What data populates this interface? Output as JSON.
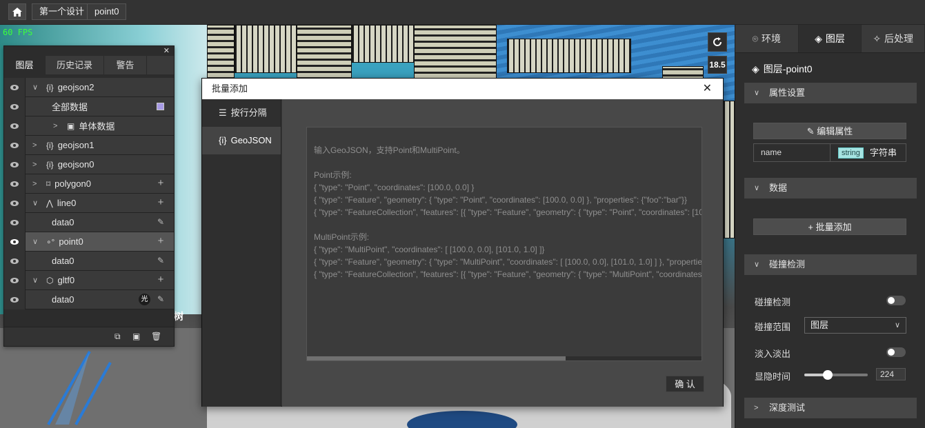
{
  "topbar": {
    "breadcrumbs": [
      "第一个设计",
      "point0"
    ]
  },
  "viewport": {
    "fps": "60 FPS",
    "height_readout": "18.5",
    "building_label": "树"
  },
  "layers_panel": {
    "tabs": [
      "图层",
      "历史记录",
      "警告"
    ],
    "rows": [
      {
        "label": "geojson2",
        "icon": "geojson-icon",
        "chev": "v"
      },
      {
        "label": "全部数据",
        "icon": "",
        "chev": ""
      },
      {
        "label": "单体数据",
        "icon": "image-icon",
        "chev": ">"
      },
      {
        "label": "geojson1",
        "icon": "geojson-icon",
        "chev": ">"
      },
      {
        "label": "geojson0",
        "icon": "geojson-icon",
        "chev": ">"
      },
      {
        "label": "polygon0",
        "icon": "polygon-icon",
        "chev": ">"
      },
      {
        "label": "line0",
        "icon": "line-icon",
        "chev": "v"
      },
      {
        "label": "data0",
        "icon": "",
        "chev": ""
      },
      {
        "label": "point0",
        "icon": "point-icon",
        "chev": "v"
      },
      {
        "label": "data0",
        "icon": "",
        "chev": ""
      },
      {
        "label": "gltf0",
        "icon": "cube-icon",
        "chev": "v"
      },
      {
        "label": "data0",
        "icon": "",
        "chev": ""
      }
    ],
    "guang_badge": "光"
  },
  "modal": {
    "title": "批量添加",
    "tabs": [
      "按行分隔",
      "GeoJSON"
    ],
    "active_tab": "GeoJSON",
    "lines": [
      "输入GeoJSON，支持Point和MultiPoint。",
      "",
      "Point示例:",
      "{ \"type\": \"Point\", \"coordinates\": [100.0, 0.0] }",
      "{ \"type\": \"Feature\", \"geometry\": { \"type\": \"Point\", \"coordinates\": [100.0, 0.0] }, \"properties\": {\"foo\":\"bar\"}}",
      "{ \"type\": \"FeatureCollection\", \"features\": [{ \"type\": \"Feature\", \"geometry\": { \"type\": \"Point\", \"coordinates\": [100",
      "",
      "MultiPoint示例:",
      "{ \"type\": \"MultiPoint\", \"coordinates\": [ [100.0, 0.0], [101.0, 1.0] ]}",
      "{ \"type\": \"Feature\", \"geometry\": { \"type\": \"MultiPoint\", \"coordinates\": [ [100.0, 0.0], [101.0, 1.0] ] }, \"properties\"",
      "{ \"type\": \"FeatureCollection\", \"features\": [{ \"type\": \"Feature\", \"geometry\": { \"type\": \"MultiPoint\", \"coordinates\""
    ],
    "confirm_label": "确 认"
  },
  "right_panel": {
    "tabs": [
      "环境",
      "图层",
      "后处理"
    ],
    "active_tab": "图层",
    "title": "图层-point0",
    "sections": {
      "attr_settings": "属性设置",
      "data": "数据",
      "collision": "碰撞检测",
      "depth_test": "深度测试"
    },
    "edit_attr_btn": "编辑属性",
    "attr_row": {
      "name": "name",
      "type_tag": "string",
      "type_label": "字符串"
    },
    "batch_add_btn": "批量添加",
    "collision_label": "碰撞检测",
    "collision_range_label": "碰撞范围",
    "collision_range_value": "图层",
    "fade_label": "淡入淡出",
    "fade_time_label": "显隐时间",
    "fade_time_value": "224",
    "fade_time_slider_fraction": 0.37,
    "collision_on": false,
    "fade_on": false
  }
}
